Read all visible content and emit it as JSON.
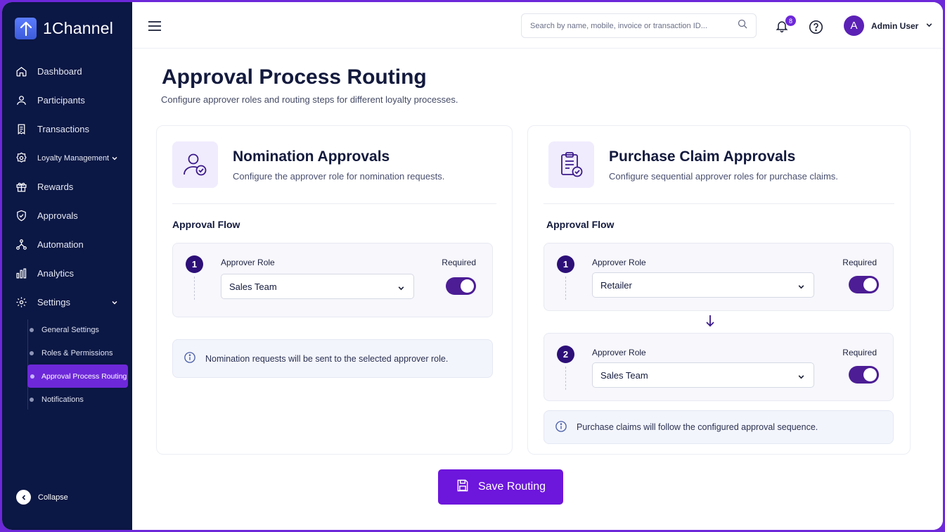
{
  "brand": {
    "name": "1Channel"
  },
  "sidebar": {
    "items": [
      {
        "label": "Dashboard",
        "icon": "home-icon"
      },
      {
        "label": "Participants",
        "icon": "user-icon"
      },
      {
        "label": "Transactions",
        "icon": "receipt-icon"
      },
      {
        "label": "Loyalty Management",
        "icon": "gear-badge-icon"
      },
      {
        "label": "Rewards",
        "icon": "gift-icon"
      },
      {
        "label": "Approvals",
        "icon": "shield-check-icon"
      },
      {
        "label": "Automation",
        "icon": "workflow-icon"
      },
      {
        "label": "Analytics",
        "icon": "bar-chart-icon"
      },
      {
        "label": "Settings",
        "icon": "gear-icon"
      }
    ],
    "settings_sub": [
      {
        "label": "General Settings"
      },
      {
        "label": "Roles & Permissions"
      },
      {
        "label": "Approval Process Routing"
      },
      {
        "label": "Notifications"
      }
    ],
    "active_sub": "Approval Process Routing",
    "collapse_label": "Collapse"
  },
  "topbar": {
    "search_placeholder": "Search by name, mobile, invoice or transaction ID...",
    "notification_count": "8",
    "avatar_letter": "A",
    "user_name": "Admin User"
  },
  "page": {
    "title": "Approval Process Routing",
    "subtitle": "Configure approver roles and routing steps for different loyalty processes."
  },
  "nomination": {
    "title": "Nomination Approvals",
    "description": "Configure the approver role for nomination requests.",
    "flow_label": "Approval Flow",
    "steps": [
      {
        "number": "1",
        "role_label": "Approver Role",
        "role_value": "Sales Team",
        "required_label": "Required",
        "required": true
      }
    ],
    "info": "Nomination requests will be sent to the selected approver role."
  },
  "purchase": {
    "title": "Purchase Claim Approvals",
    "description": "Configure sequential approver roles for purchase claims.",
    "flow_label": "Approval Flow",
    "steps": [
      {
        "number": "1",
        "role_label": "Approver Role",
        "role_value": "Retailer",
        "required_label": "Required",
        "required": true
      },
      {
        "number": "2",
        "role_label": "Approver Role",
        "role_value": "Sales Team",
        "required_label": "Required",
        "required": true
      }
    ],
    "info": "Purchase claims will follow the configured approval sequence."
  },
  "actions": {
    "save_label": "Save Routing"
  },
  "colors": {
    "sidebar_bg": "#0b1744",
    "accent": "#6d28d9",
    "toggle_on": "#4c1d95"
  }
}
